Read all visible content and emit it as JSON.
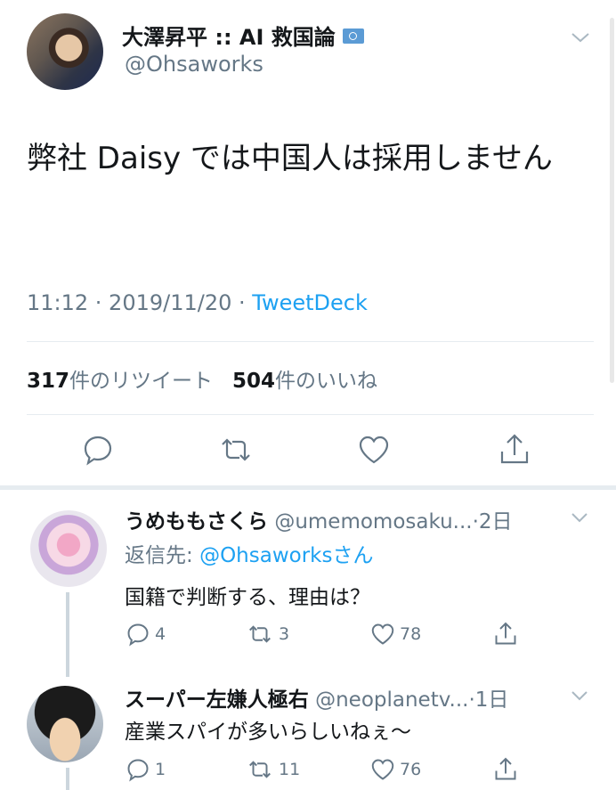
{
  "tweet": {
    "author_name": "大澤昇平 :: AI 救国論",
    "author_handle": "@Ohsaworks",
    "text": "弊社 Daisy では中国人は採用しません",
    "time": "11:12 · 2019/11/20 ·",
    "source": "TweetDeck",
    "retweet_count": "317",
    "retweet_label": "件のリツイート",
    "like_count": "504",
    "like_label": "件のいいね"
  },
  "replies": [
    {
      "name": "うめももさくら",
      "handle": "@umemomosaku...",
      "age": "·2日",
      "reply_to_prefix": "返信先:",
      "reply_to_handle": "@Ohsaworks",
      "reply_to_suffix": "さん",
      "text": "国籍で判断する、理由は？",
      "replies": "4",
      "retweets": "3",
      "likes": "78"
    },
    {
      "name": "スーパー左嫌人極右",
      "handle": "@neoplanetv...",
      "age": "·1日",
      "text": "産業スパイが多いらしいねぇ〜",
      "replies": "1",
      "retweets": "11",
      "likes": "76"
    }
  ],
  "icons": {
    "chevron": "chevron-down-icon",
    "reply": "reply-icon",
    "retweet": "retweet-icon",
    "like": "heart-icon",
    "share": "share-icon",
    "badge": "un-flag-icon"
  },
  "colors": {
    "link": "#1da1f2",
    "secondary": "#657786",
    "icon": "#657786",
    "divider": "#e6ecf0"
  }
}
